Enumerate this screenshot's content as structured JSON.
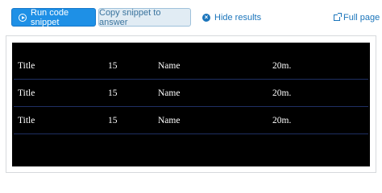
{
  "toolbar": {
    "run_label": "Run code snippet",
    "copy_label": "Copy snippet to answer",
    "hide_label": "Hide results",
    "full_label": "Full page"
  },
  "icons": {
    "run": "play-circle-icon",
    "hide": "close-circle-icon",
    "full": "external-link-icon"
  },
  "colors": {
    "run_button": "#1e90e6",
    "copy_button": "#e1ecf4",
    "link": "#1b75bb",
    "result_background": "#000000",
    "row_divider": "#1f2f63"
  },
  "table": {
    "rows": [
      [
        "Title",
        "15",
        "Name",
        "20m."
      ],
      [
        "Title",
        "15",
        "Name",
        "20m."
      ],
      [
        "Title",
        "15",
        "Name",
        "20m."
      ]
    ]
  }
}
